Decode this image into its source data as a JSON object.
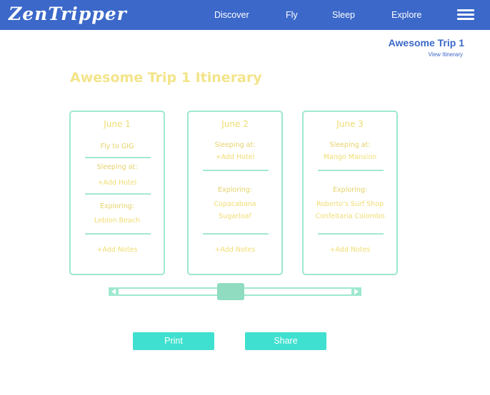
{
  "app": {
    "logo_text": "ZenTripper"
  },
  "nav": {
    "links": [
      "Discover",
      "Fly",
      "Sleep",
      "Explore"
    ]
  },
  "trip": {
    "name": "Awesome Trip 1",
    "view_itinerary": "View Itinerary"
  },
  "page": {
    "title": "Awesome Trip 1 Itinerary"
  },
  "days": [
    {
      "date": "June 1",
      "fly_prefix": "Fly to ",
      "fly_code": "GIG",
      "sleeping_label": "Sleeping at:",
      "sleeping_value": "+Add Hotel",
      "exploring_label": "Exploring:",
      "exploring": [
        "Leblon Beach"
      ],
      "notes": "+Add Notes"
    },
    {
      "date": "June 2",
      "sleeping_label": "Sleeping at:",
      "sleeping_value": "+Add Hotel",
      "exploring_label": "Exploring:",
      "exploring": [
        "Copacabana",
        "Sugarloaf"
      ],
      "notes": "+Add Notes"
    },
    {
      "date": "June 3",
      "sleeping_label": "Sleeping at:",
      "sleeping_value": "Mango Mansion",
      "exploring_label": "Exploring:",
      "exploring": [
        "Roberto's Surf Shop",
        "Confeitaria Colombo"
      ],
      "notes": "+Add Notes"
    }
  ],
  "actions": {
    "print": "Print",
    "share": "Share"
  },
  "icons": {
    "menu": "hamburger-menu-icon",
    "scroll_left": "triangle-left-icon",
    "scroll_right": "triangle-right-icon"
  },
  "colors": {
    "header": "#3b68c9",
    "accent_yellow": "#f3e48a",
    "card_border": "#9ee8cf",
    "button": "#3fe0cf"
  }
}
